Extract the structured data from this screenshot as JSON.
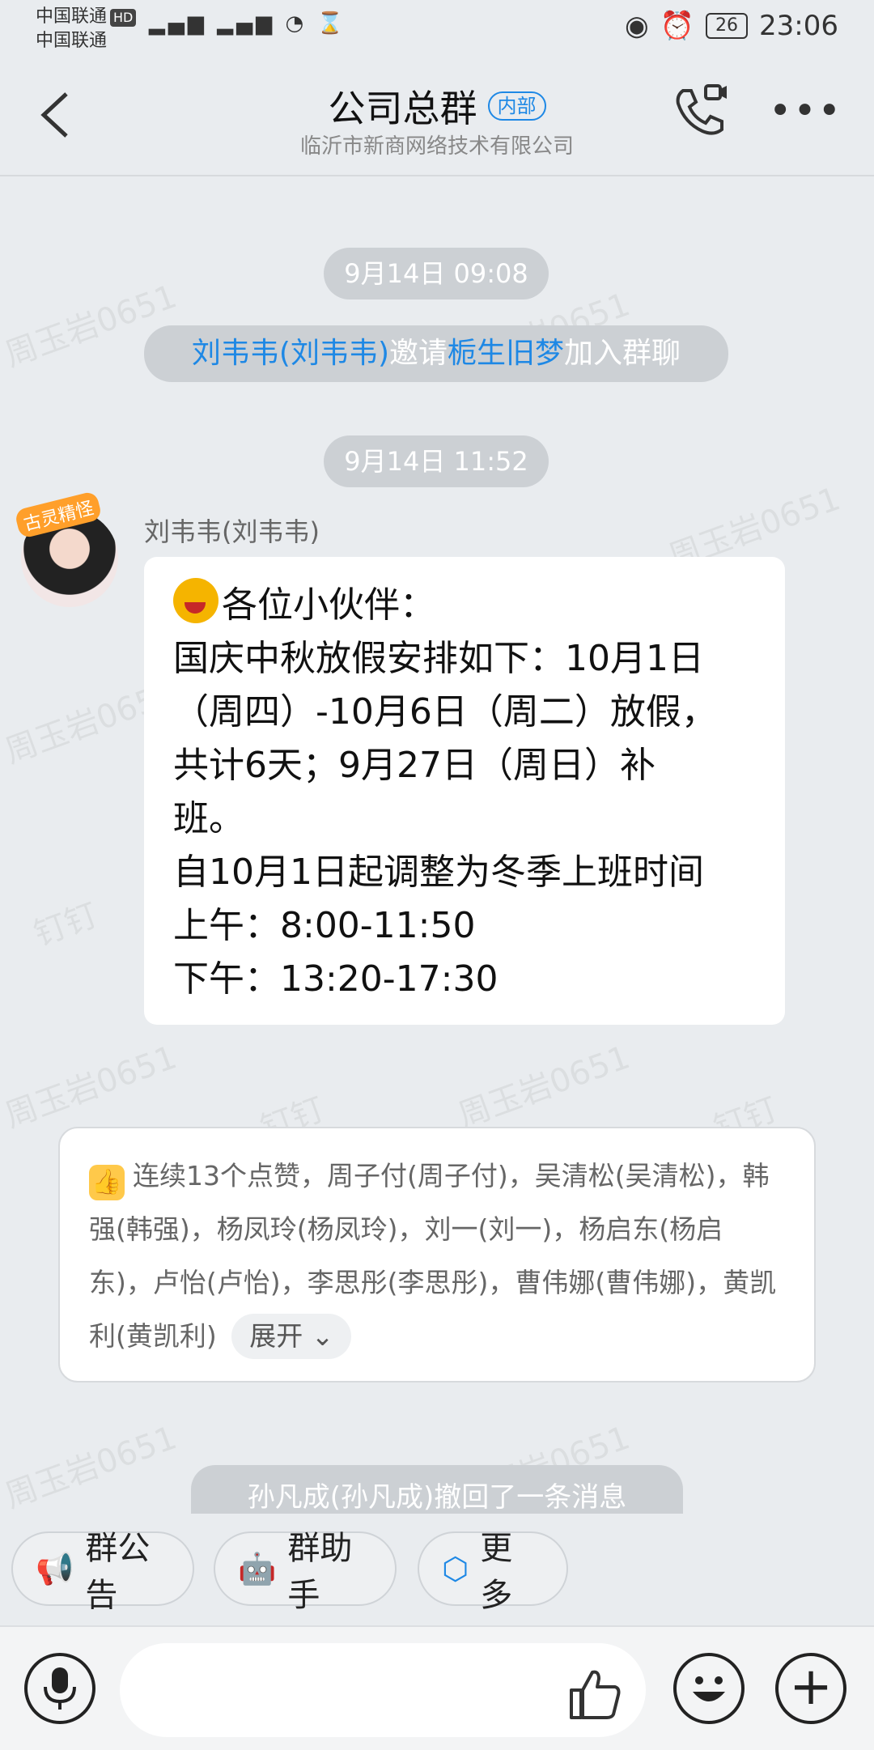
{
  "status_bar": {
    "carrier1": "中国联通",
    "carrier2": "中国联通",
    "hd": "HD",
    "battery": "26",
    "time": "23:06"
  },
  "header": {
    "title": "公司总群",
    "tag": "内部",
    "subtitle": "临沂市新商网络技术有限公司"
  },
  "messages": {
    "time1": "9月14日 09:08",
    "join": {
      "inviter": "刘韦韦(刘韦韦)",
      "verb": "邀请",
      "invitee": "栀生旧梦",
      "suffix": "加入群聊"
    },
    "time2": "9月14日 11:52",
    "sender": "刘韦韦(刘韦韦)",
    "avatar_badge": "古灵精怪",
    "lines": [
      "各位小伙伴：",
      "国庆中秋放假安排如下：10月1日",
      "（周四）-10月6日（周二）放假，",
      "共计6天；9月27日（周日）补",
      "班。",
      "自10月1日起调整为冬季上班时间",
      "上午：8:00-11:50",
      "下午：13:20-17:30"
    ]
  },
  "likes": {
    "text": "连续13个点赞，周子付(周子付)，吴清松(吴清松)，韩强(韩强)，杨凤玲(杨凤玲)，刘一(刘一)，杨启东(杨启东)，卢怡(卢怡)，李思彤(李思彤)，曹伟娜(曹伟娜)，黄凯利(黄凯利)",
    "expand": "展开"
  },
  "recall": "孙凡成(孙凡成)撤回了一条消息",
  "quick_actions": {
    "announcement": "群公告",
    "assistant": "群助手",
    "more": "更多"
  },
  "watermark": [
    "周玉岩0651",
    "钉钉"
  ],
  "icons": {
    "back": "back-arrow-icon",
    "call": "video-call-icon",
    "more": "more-dots-icon",
    "mic": "microphone-icon",
    "thumbs": "thumbs-up-icon",
    "emoji": "emoji-icon",
    "plus": "plus-icon"
  }
}
